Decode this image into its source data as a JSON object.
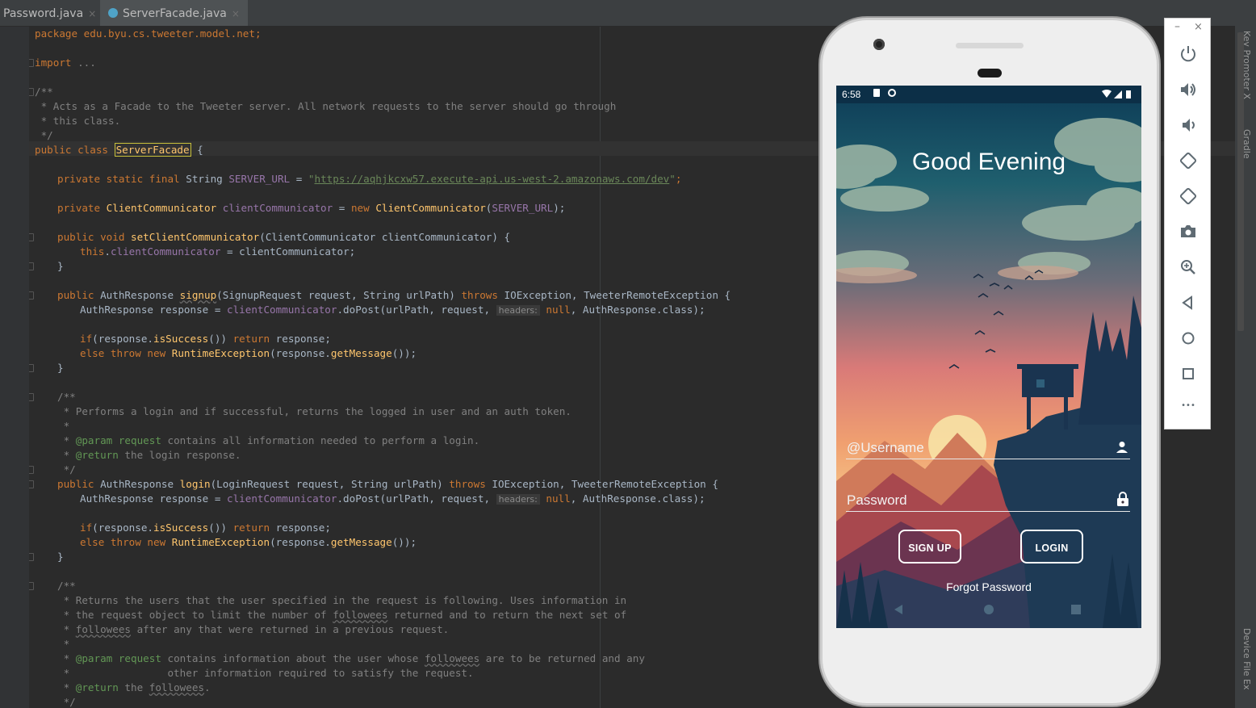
{
  "tabs": [
    {
      "label": "Password.java",
      "close": "×"
    },
    {
      "label": "ServerFacade.java",
      "close": "×"
    }
  ],
  "code": {
    "l01": "package edu.byu.cs.tweeter.model.net;",
    "import_kw": "import",
    "import_rest": " ...",
    "l05": "/**",
    "l06": " * Acts as a Facade to the Tweeter server. All network requests to the server should go through",
    "l07": " * this class.",
    "l08": " */",
    "l09_kw": "public class ",
    "l09_name": "ServerFacade",
    "l09_end": " {",
    "url_kw": "private static final ",
    "url_type": "String ",
    "url_field": "SERVER_URL",
    "url_eq": " = ",
    "url_q1": "\"",
    "url_val": "https://aqhjkcxw57.execute-api.us-west-2.amazonaws.com/dev",
    "url_q2": "\"",
    "url_end": ";",
    "cc_kw": "private ",
    "cc_type": "ClientCommunicator ",
    "cc_field": "clientCommunicator",
    "cc_mid": " = ",
    "cc_new": "new ",
    "cc_call": "ClientCommunicator",
    "cc_arg_open": "(",
    "cc_arg": "SERVER_URL",
    "cc_arg_close": ");",
    "set_kw": "public void ",
    "set_fn": "setClientCommunicator",
    "set_rest": "(ClientCommunicator clientCommunicator) {",
    "this_kw": "this",
    "this_dot": ".",
    "this_field": "clientCommunicator",
    "this_rest": " = clientCommunicator;",
    "close_brace": "}",
    "su_kw": "public ",
    "su_type": "AuthResponse ",
    "su_fn": "signup",
    "su_args": "(SignupRequest request, String urlPath) ",
    "throws_kw": "throws ",
    "su_ex": "IOException, TweeterRemoteException {",
    "resp_type": "AuthResponse ",
    "resp_var": "response = ",
    "resp_field": "clientCommunicator",
    "resp_call": ".doPost(urlPath, request, ",
    "hint_headers": "headers:",
    "resp_null": " null",
    "resp_tail": ", AuthResponse.class);",
    "if_kw": "if",
    "if_cond": "(response.",
    "if_fn": "isSuccess",
    "if_close": "()) ",
    "return_kw": "return ",
    "return_rest": "response;",
    "else_kw": "else throw new ",
    "else_type": "RuntimeException",
    "else_rest": "(response.",
    "else_fn": "getMessage",
    "else_end": "());",
    "doc_open": "/**",
    "doc_login1": " * Performs a login and if successful, returns the logged in user and an auth token.",
    "doc_star": " *",
    "doc_tag": "@param ",
    "doc_param_name": "request ",
    "doc_param_text": "contains all information needed to perform a login.",
    "doc_return_tag": "@return ",
    "doc_return_text": "the login response.",
    "doc_close": " */",
    "li_fn": "login",
    "li_args": "(LoginRequest request, String urlPath) ",
    "doc_f1": " * Returns the users that the user specified in the request is following. Uses information in",
    "doc_f2a": " * the request object to limit the number of ",
    "doc_f2b": "followees",
    "doc_f2c": " returned and to return the next set of",
    "doc_f3a": " * ",
    "doc_f3b": "followees",
    "doc_f3c": " after any that were returned in a previous request.",
    "doc_f5a": "contains information about the user whose ",
    "doc_f5b": "followees",
    "doc_f5c": " are to be returned and any",
    "doc_f6": " *                other information required to satisfy the request.",
    "doc_f7b": "the ",
    "doc_f7c": "followees",
    "doc_f7d": "."
  },
  "side_labels": {
    "top": "Key Promoter X",
    "mid": "Gradle",
    "bottom": "Device File Ex"
  },
  "phone": {
    "status": {
      "time": "6:58"
    },
    "greeting": "Good Evening",
    "username_placeholder": "@Username",
    "password_placeholder": "Password",
    "signup_label": "SIGN UP",
    "login_label": "LOGIN",
    "forgot_label": "Forgot Password"
  },
  "emulator_toolbar": {
    "minimize": "–",
    "close": "×",
    "more": "•••"
  },
  "colors": {
    "editor_bg": "#2b2b2b",
    "keyword": "#cc7832",
    "string": "#6a8759",
    "field": "#9876aa",
    "method": "#ffc66d",
    "comment": "#808080",
    "doc": "#629755"
  }
}
